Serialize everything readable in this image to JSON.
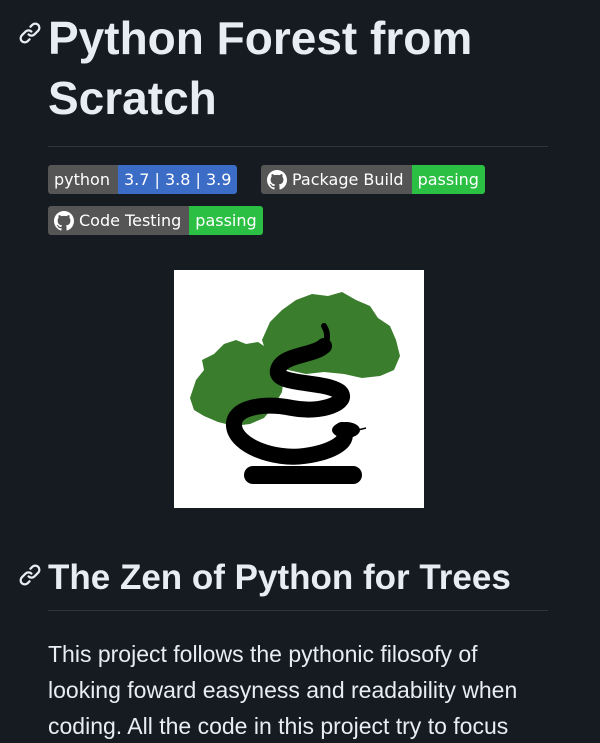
{
  "header": {
    "title": "Python Forest from Scratch",
    "anchor_icon": "link-icon"
  },
  "badges": [
    {
      "label": "python",
      "value": "3.7 | 3.8 | 3.9",
      "color": "#3b6cc6",
      "icon": ""
    },
    {
      "label": "Package Build",
      "value": "passing",
      "color": "#2bc043",
      "icon": "github-icon"
    },
    {
      "label": "Code Testing",
      "value": "passing",
      "color": "#2bc043",
      "icon": "github-icon"
    }
  ],
  "logo": {
    "name": "bonsai-python-logo",
    "tree_color": "#3a7d2c",
    "snake_color": "#000000"
  },
  "section": {
    "heading": "The Zen of Python for Trees",
    "anchor_icon": "link-icon",
    "paragraph": "This project follows the pythonic filosofy of looking foward easyness and readability when coding. All the code in this project try to focus"
  },
  "theme": {
    "background": "#161b22",
    "text": "#e6edf3",
    "rule": "#30363d"
  }
}
